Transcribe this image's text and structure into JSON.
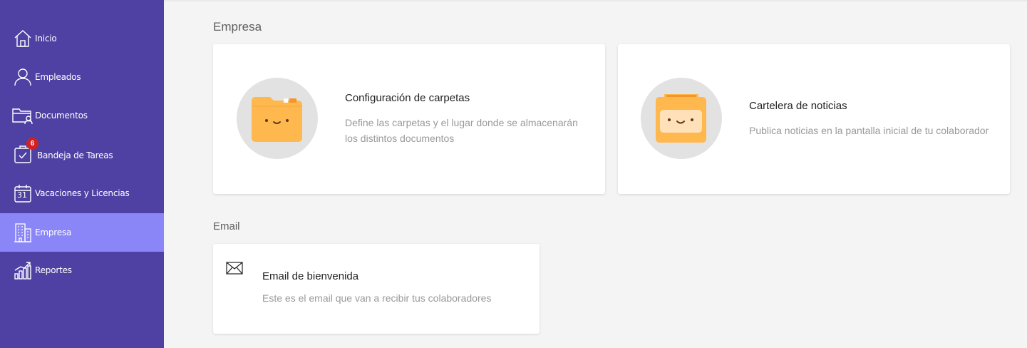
{
  "sidebar": {
    "items": [
      {
        "label": "Inicio",
        "icon": "home-icon"
      },
      {
        "label": "Empleados",
        "icon": "user-icon"
      },
      {
        "label": "Documentos",
        "icon": "folder-user-icon"
      },
      {
        "label": "Bandeja de Tareas",
        "icon": "clipboard-check-icon",
        "badge": "6"
      },
      {
        "label": "Vacaciones y Licencias",
        "icon": "calendar-icon",
        "day": "31"
      },
      {
        "label": "Empresa",
        "icon": "building-icon",
        "active": true
      },
      {
        "label": "Reportes",
        "icon": "chart-growth-icon"
      }
    ]
  },
  "main": {
    "sections": [
      {
        "title": "Empresa",
        "cards": [
          {
            "title": "Configuración de carpetas",
            "description": "Define las carpetas y el lugar donde se almacenarán los distintos documentos",
            "icon": "folder-face-icon"
          },
          {
            "title": "Cartelera de noticias",
            "description": "Publica noticias en la pantalla inicial de tu colaborador",
            "icon": "board-face-icon"
          }
        ]
      },
      {
        "title": "Email",
        "cards": [
          {
            "title": "Email de bienvenida",
            "description": "Este es el email que van a recibir tus colaboradores",
            "icon": "envelope-icon"
          }
        ]
      }
    ]
  },
  "colors": {
    "sidebar_bg": "#4f41a3",
    "sidebar_active": "#8a86f8",
    "badge": "#d32020",
    "illustration_orange": "#ffb84d",
    "page_bg": "#f4f4f4"
  }
}
